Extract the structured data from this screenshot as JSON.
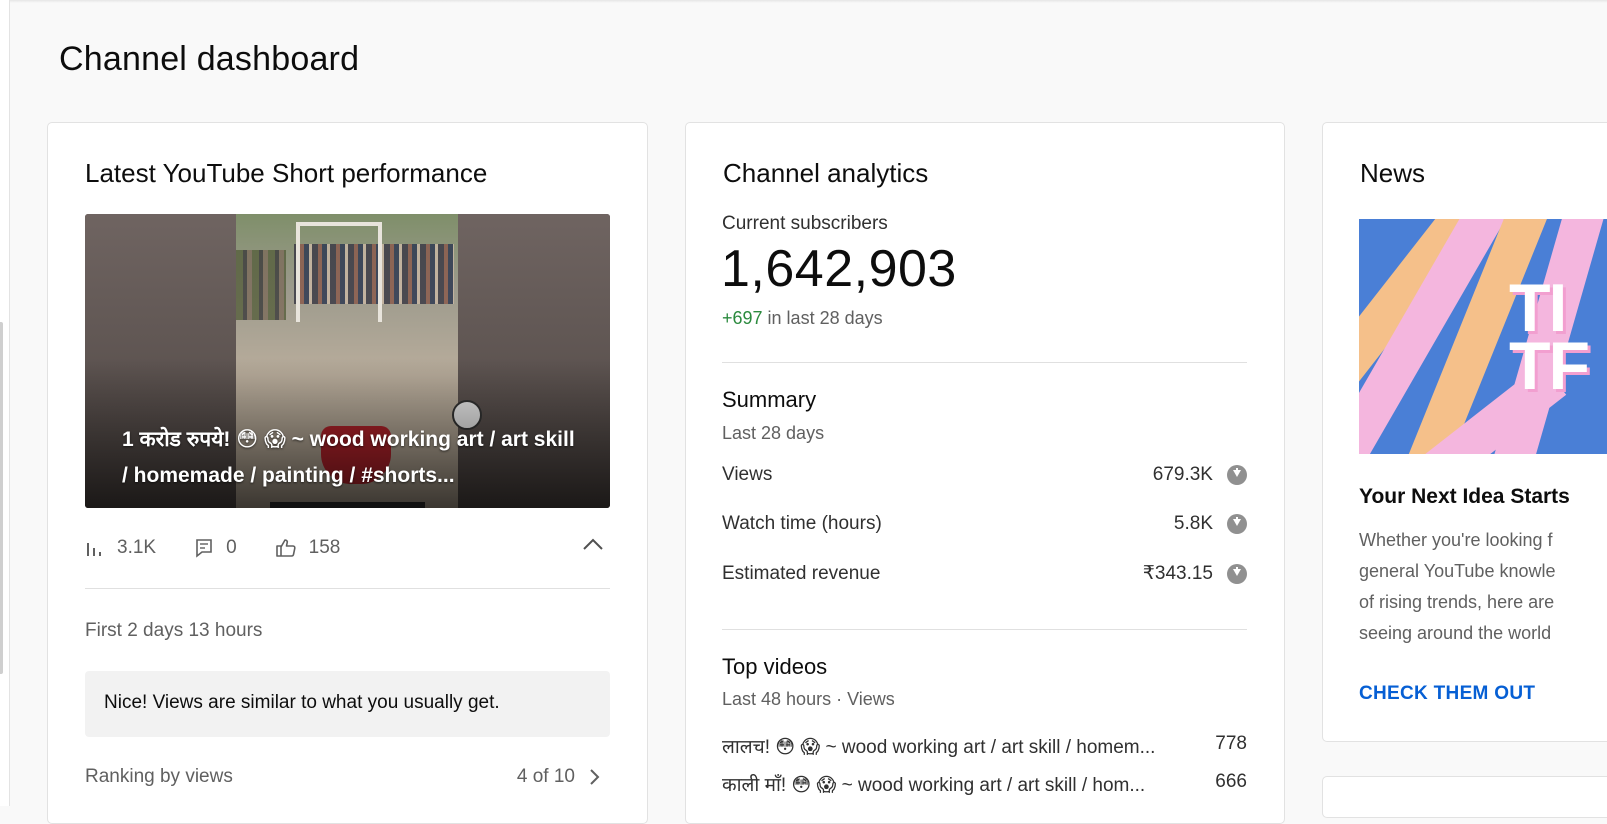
{
  "page": {
    "title": "Channel dashboard"
  },
  "short_card": {
    "title": "Latest YouTube Short performance",
    "video_title": "1 करोड रुपये! 😳 😱 ~ wood working art / art skill / homemade / painting / #shorts...",
    "stats": {
      "views": "3.1K",
      "comments": "0",
      "likes": "158"
    },
    "period": "First 2 days 13 hours",
    "note": "Nice! Views are similar to what you usually get.",
    "ranking_label": "Ranking by views",
    "ranking_value": "4 of 10"
  },
  "analytics_card": {
    "title": "Channel analytics",
    "subscribers_label": "Current subscribers",
    "subscribers_count": "1,642,903",
    "subscribers_delta": "+697",
    "subscribers_delta_suffix": " in last 28 days",
    "summary": {
      "title": "Summary",
      "period": "Last 28 days",
      "metrics": [
        {
          "label": "Views",
          "value": "679.3K"
        },
        {
          "label": "Watch time (hours)",
          "value": "5.8K"
        },
        {
          "label": "Estimated revenue",
          "value": "₹343.15"
        }
      ]
    },
    "top_videos": {
      "title": "Top videos",
      "period": "Last 48 hours · Views",
      "items": [
        {
          "title": "लालच! 😳 😱 ~ wood working art / art skill / homem...",
          "views": "778"
        },
        {
          "title": "काली माँ! 😳 😱 ~ wood working art / art skill / hom...",
          "views": "666"
        }
      ]
    }
  },
  "news_card": {
    "title": "News",
    "image_text": "TI TF",
    "headline": "Your Next Idea Starts",
    "body": [
      "Whether you're looking f",
      "general YouTube knowle",
      "of rising trends, here are",
      "seeing around the world"
    ],
    "cta": "CHECK THEM OUT"
  },
  "colors": {
    "accent": "#065fd4",
    "positive": "#2b8a3e",
    "muted": "#606060"
  }
}
